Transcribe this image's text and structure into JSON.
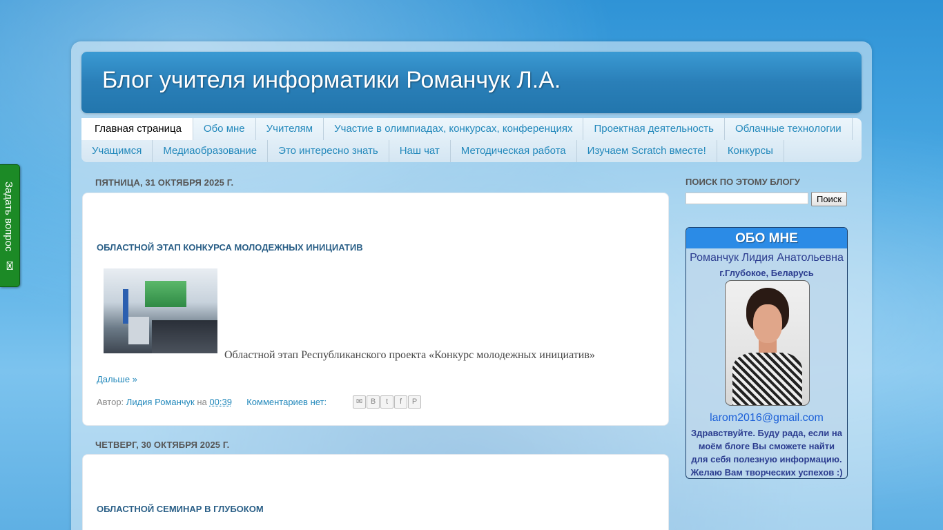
{
  "blog": {
    "title": "Блог учителя информатики Романчук Л.А."
  },
  "nav": {
    "row1": [
      "Главная страница",
      "Обо мне",
      "Учителям",
      "Участие в олимпиадах, конкурсах, конференциях",
      "Проектная деятельность",
      "Облачные технологии"
    ],
    "row2": [
      "Учащимся",
      "Медиаобразование",
      "Это интересно знать",
      "Наш чат",
      "Методическая работа",
      "Изучаем Scratch вместе!",
      "Конкурсы"
    ],
    "active": "Главная страница"
  },
  "feedback_tab": {
    "label": "Задать вопрос",
    "icon": "envelope-icon"
  },
  "posts": [
    {
      "date": "ПЯТНИЦА, 31 ОКТЯБРЯ 2025 Г.",
      "title": "ОБЛАСТНОЙ ЭТАП КОНКУРСА МОЛОДЕЖНЫХ ИНИЦИАТИВ",
      "excerpt": "Областной этап Республиканского проекта «Конкурс молодежных инициатив»",
      "more": "Дальше »",
      "author_prefix": "Автор:",
      "author": "Лидия Романчук",
      "on": "на",
      "time": "00:39",
      "comments": "Комментариев нет:",
      "share_icons": [
        "email-icon",
        "blogger-icon",
        "twitter-icon",
        "facebook-icon",
        "pinterest-icon"
      ]
    },
    {
      "date": "ЧЕТВЕРГ, 30 ОКТЯБРЯ 2025 Г.",
      "title": "ОБЛАСТНОЙ СЕМИНАР В ГЛУБОКОМ"
    }
  ],
  "sidebar": {
    "search_title": "ПОИСК ПО ЭТОМУ БЛОГУ",
    "search_value": "",
    "search_button": "Поиск",
    "about": {
      "heading": "ОБО МНЕ",
      "name": "Романчук Лидия Анатольевна",
      "city": "г.Глубокое, Беларусь",
      "email": "larom2016@gmail.com",
      "text": "Здравствуйте. Буду рада, если на моём блоге Вы сможете найти для себя полезную информацию. Желаю Вам творческих успехов :)"
    }
  },
  "colors": {
    "accent": "#2288bb",
    "header_blue": "#2a7fb8",
    "feedback_green": "#1c8a26",
    "about_head": "#2b8be6"
  }
}
